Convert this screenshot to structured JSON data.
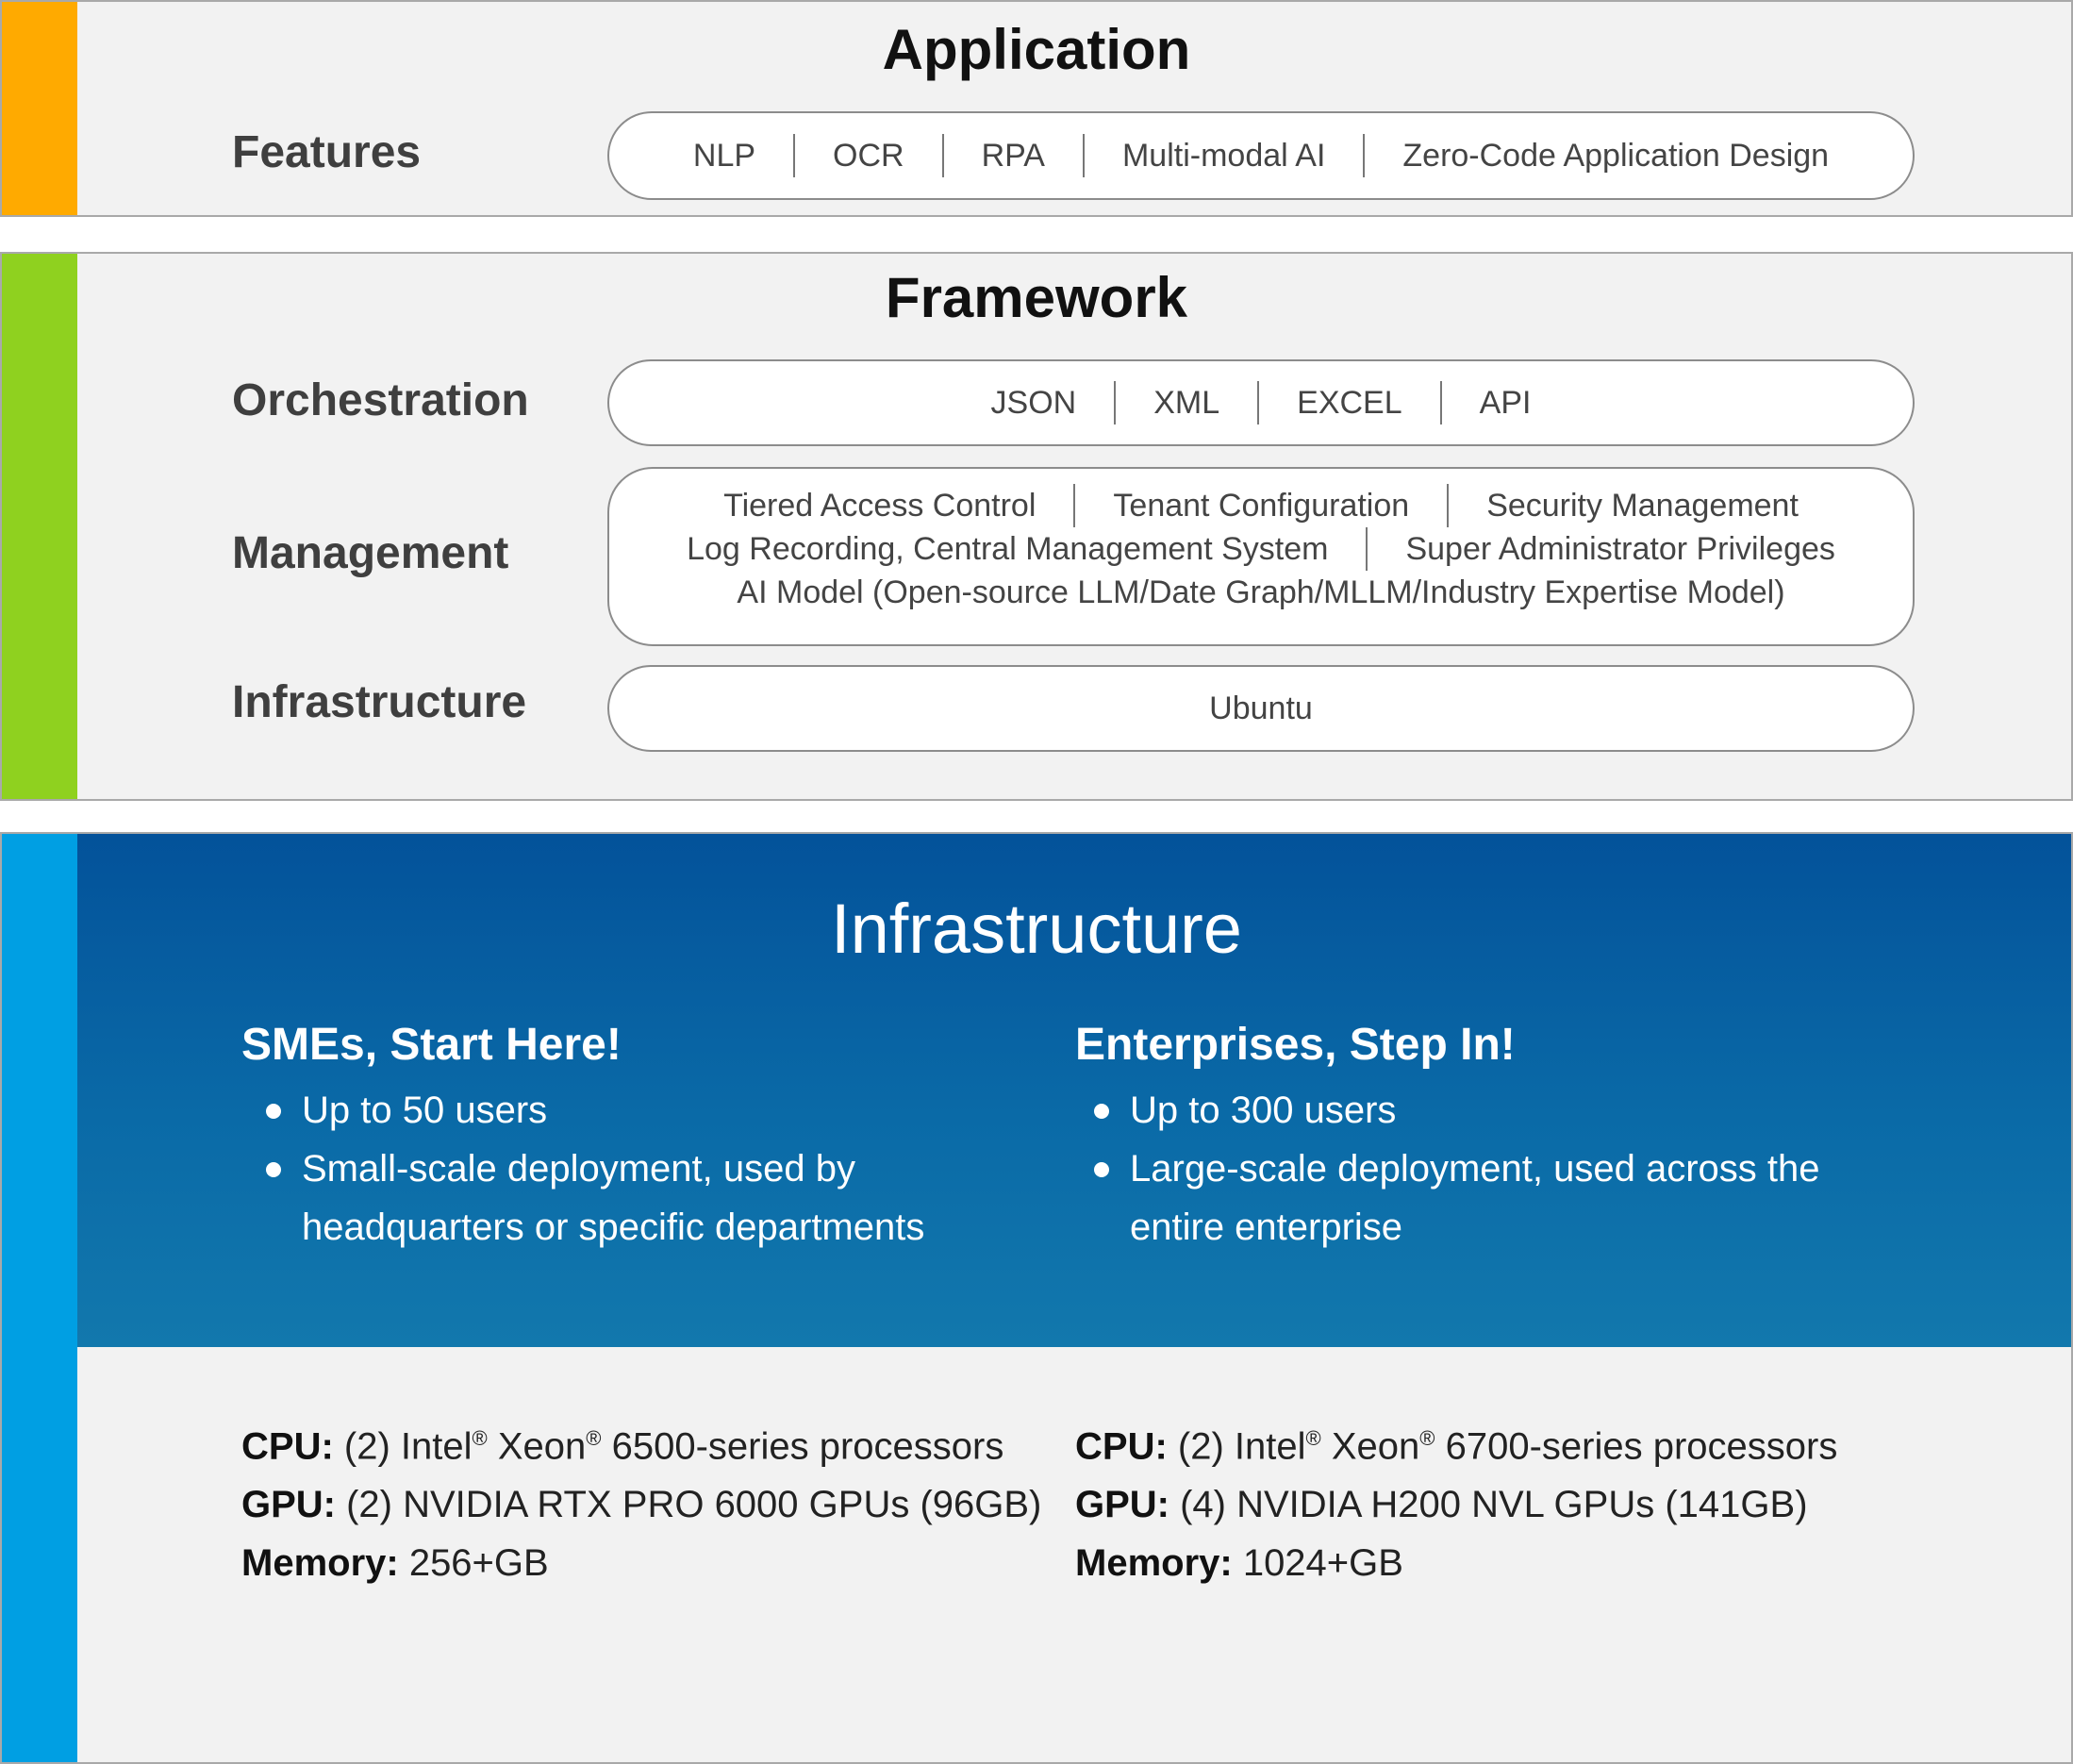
{
  "application": {
    "title": "Application",
    "strip_color": "#ffaa00",
    "features_label": "Features",
    "features": [
      "NLP",
      "OCR",
      "RPA",
      "Multi-modal AI",
      "Zero-Code Application Design"
    ]
  },
  "framework": {
    "title": "Framework",
    "strip_color": "#8fd11f",
    "orchestration_label": "Orchestration",
    "orchestration": [
      "JSON",
      "XML",
      "EXCEL",
      "API"
    ],
    "management_label": "Management",
    "management_line1": [
      "Tiered Access Control",
      "Tenant Configuration",
      "Security Management"
    ],
    "management_line2": [
      "Log Recording, Central Management System",
      "Super Administrator Privileges"
    ],
    "management_line3": "AI Model (Open-source LLM/Date Graph/MLLM/Industry Expertise Model)",
    "infrastructure_label": "Infrastructure",
    "infrastructure_value": "Ubuntu"
  },
  "infrastructure": {
    "title": "Infrastructure",
    "strip_color": "#009fe3",
    "sme": {
      "heading": "SMEs, Start Here!",
      "bullet1": "Up to 50 users",
      "bullet2_line1": "Small-scale deployment, used by",
      "bullet2_line2": "headquarters or specific departments",
      "cpu_label": "CPU:",
      "cpu_pre": " (2) Intel",
      "cpu_reg1": "®",
      "cpu_mid": " Xeon",
      "cpu_reg2": "®",
      "cpu_post": " 6500-series processors",
      "gpu_label": "GPU:",
      "gpu_value": " (2) NVIDIA RTX PRO 6000 GPUs (96GB)",
      "memory_label": "Memory:",
      "memory_value": " 256+GB"
    },
    "enterprise": {
      "heading": "Enterprises, Step In!",
      "bullet1": "Up to 300 users",
      "bullet2_line1": "Large-scale deployment, used across the",
      "bullet2_line2": "entire enterprise",
      "cpu_label": "CPU:",
      "cpu_pre": " (2) Intel",
      "cpu_reg1": "®",
      "cpu_mid": " Xeon",
      "cpu_reg2": "®",
      "cpu_post": " 6700-series processors",
      "gpu_label": "GPU:",
      "gpu_value": " (4) NVIDIA H200 NVL GPUs (141GB)",
      "memory_label": "Memory:",
      "memory_value": " 1024+GB"
    }
  }
}
